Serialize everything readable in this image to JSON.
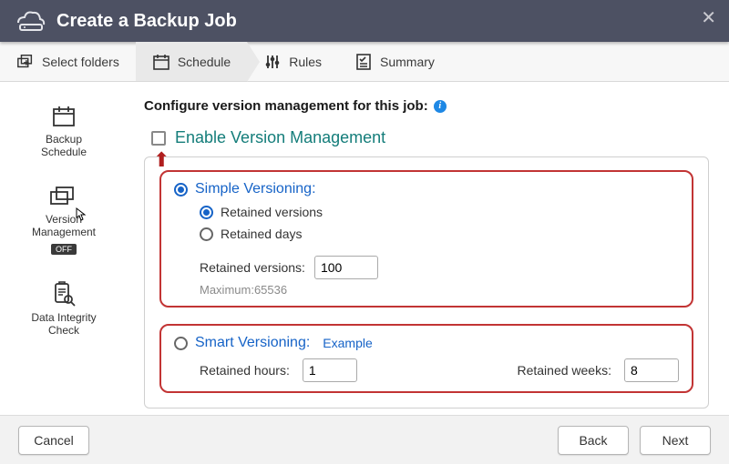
{
  "header": {
    "title": "Create a Backup Job"
  },
  "steps": [
    {
      "label": "Select folders"
    },
    {
      "label": "Schedule"
    },
    {
      "label": "Rules"
    },
    {
      "label": "Summary"
    }
  ],
  "sidebar": {
    "items": [
      {
        "label": "Backup\nSchedule"
      },
      {
        "label": "Version\nManagement",
        "badge": "OFF"
      },
      {
        "label": "Data Integrity\nCheck"
      }
    ]
  },
  "content": {
    "heading": "Configure version management for this job:",
    "enable_label": "Enable Version Management",
    "simple": {
      "title": "Simple Versioning:",
      "opt_versions": "Retained versions",
      "opt_days": "Retained days",
      "field_label": "Retained versions:",
      "field_value": "100",
      "max_note": "Maximum:65536"
    },
    "smart": {
      "title": "Smart Versioning:",
      "example": "Example",
      "hours_label": "Retained hours:",
      "hours_value": "1",
      "weeks_label": "Retained weeks:",
      "weeks_value": "8"
    }
  },
  "footer": {
    "cancel": "Cancel",
    "back": "Back",
    "next": "Next"
  }
}
